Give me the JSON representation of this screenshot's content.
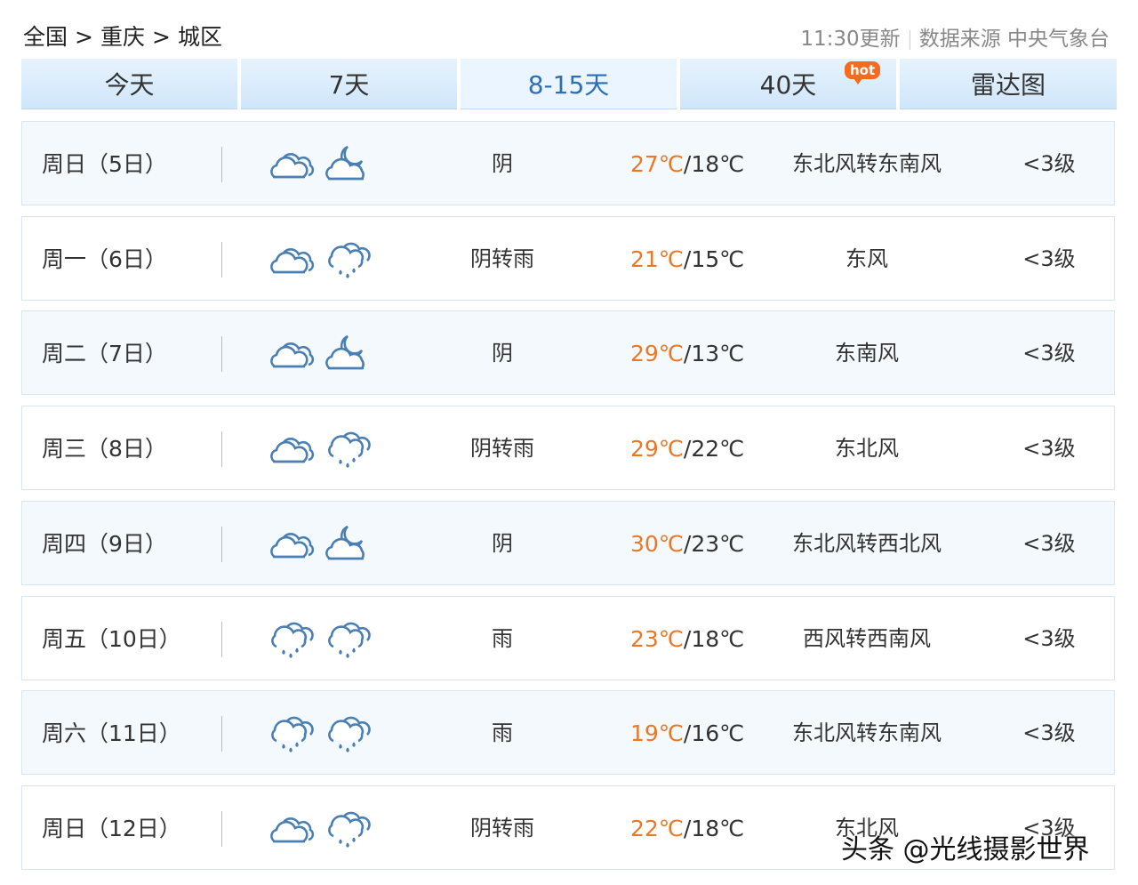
{
  "breadcrumb": {
    "items": [
      "全国",
      "重庆",
      "城区"
    ],
    "separator": ">"
  },
  "meta": {
    "update_time": "11:30更新",
    "source_label": "数据来源",
    "source": "中央气象台"
  },
  "tabs": [
    {
      "label": "今天",
      "active": false
    },
    {
      "label": "7天",
      "active": false
    },
    {
      "label": "8-15天",
      "active": true
    },
    {
      "label": "40天",
      "active": false,
      "badge": "hot"
    },
    {
      "label": "雷达图",
      "active": false
    }
  ],
  "days": [
    {
      "day": "周日（5日）",
      "icon_day": "overcast-cloud-icon",
      "icon_night": "cloudy-night-icon",
      "condition": "阴",
      "high": "27℃",
      "low": "18℃",
      "wind": "东北风转东南风",
      "level": "<3级"
    },
    {
      "day": "周一（6日）",
      "icon_day": "overcast-cloud-icon",
      "icon_night": "rain-cloud-icon",
      "condition": "阴转雨",
      "high": "21℃",
      "low": "15℃",
      "wind": "东风",
      "level": "<3级"
    },
    {
      "day": "周二（7日）",
      "icon_day": "overcast-cloud-icon",
      "icon_night": "cloudy-night-icon",
      "condition": "阴",
      "high": "29℃",
      "low": "13℃",
      "wind": "东南风",
      "level": "<3级"
    },
    {
      "day": "周三（8日）",
      "icon_day": "overcast-cloud-icon",
      "icon_night": "rain-cloud-icon",
      "condition": "阴转雨",
      "high": "29℃",
      "low": "22℃",
      "wind": "东北风",
      "level": "<3级"
    },
    {
      "day": "周四（9日）",
      "icon_day": "overcast-cloud-icon",
      "icon_night": "cloudy-night-icon",
      "condition": "阴",
      "high": "30℃",
      "low": "23℃",
      "wind": "东北风转西北风",
      "level": "<3级"
    },
    {
      "day": "周五（10日）",
      "icon_day": "rain-cloud-icon",
      "icon_night": "rain-cloud-icon",
      "condition": "雨",
      "high": "23℃",
      "low": "18℃",
      "wind": "西风转西南风",
      "level": "<3级"
    },
    {
      "day": "周六（11日）",
      "icon_day": "rain-cloud-icon",
      "icon_night": "rain-cloud-icon",
      "condition": "雨",
      "high": "19℃",
      "low": "16℃",
      "wind": "东北风转东南风",
      "level": "<3级"
    },
    {
      "day": "周日（12日）",
      "icon_day": "overcast-cloud-icon",
      "icon_night": "rain-cloud-icon",
      "condition": "阴转雨",
      "high": "22℃",
      "low": "18℃",
      "wind": "东北风",
      "level": "<3级"
    }
  ],
  "watermark": "头条 @光线摄影世界",
  "colors": {
    "accent": "#2e6fb3",
    "high_temp": "#e97829",
    "tab_bg": "#d6eafb",
    "hot_badge": "#f26b21"
  }
}
